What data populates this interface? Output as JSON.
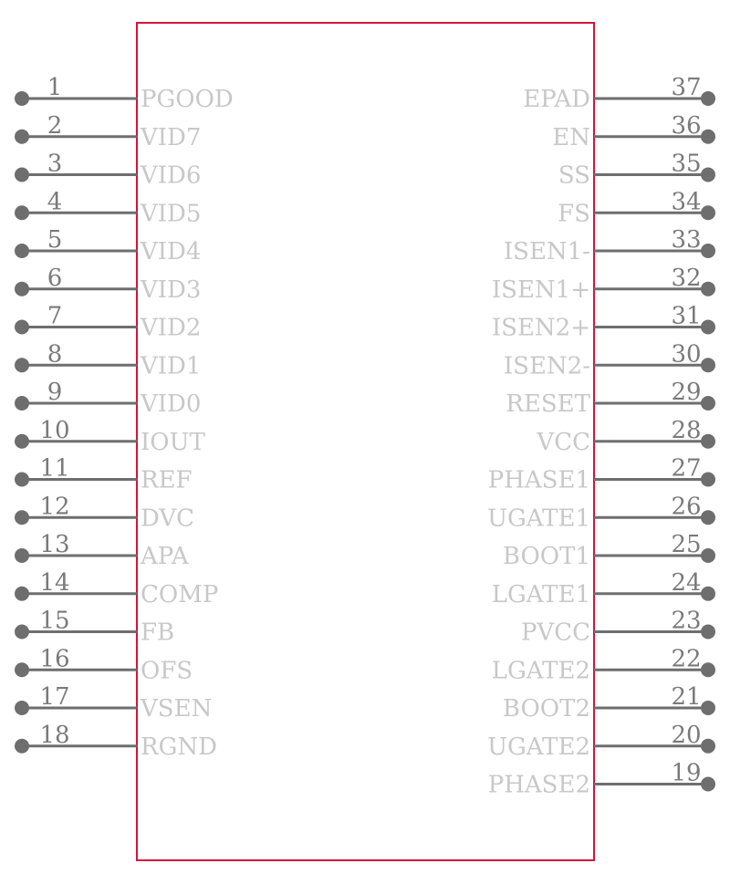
{
  "component": {
    "body_color": "#d4143c",
    "pin_color": "#6e6e6e",
    "label_color": "#c8c8c8",
    "number_color": "#7a7a7a"
  },
  "left_pins": [
    {
      "number": "1",
      "name": "PGOOD"
    },
    {
      "number": "2",
      "name": "VID7"
    },
    {
      "number": "3",
      "name": "VID6"
    },
    {
      "number": "4",
      "name": "VID5"
    },
    {
      "number": "5",
      "name": "VID4"
    },
    {
      "number": "6",
      "name": "VID3"
    },
    {
      "number": "7",
      "name": "VID2"
    },
    {
      "number": "8",
      "name": "VID1"
    },
    {
      "number": "9",
      "name": "VID0"
    },
    {
      "number": "10",
      "name": "IOUT"
    },
    {
      "number": "11",
      "name": "REF"
    },
    {
      "number": "12",
      "name": "DVC"
    },
    {
      "number": "13",
      "name": "APA"
    },
    {
      "number": "14",
      "name": "COMP"
    },
    {
      "number": "15",
      "name": "FB"
    },
    {
      "number": "16",
      "name": "OFS"
    },
    {
      "number": "17",
      "name": "VSEN"
    },
    {
      "number": "18",
      "name": "RGND"
    }
  ],
  "right_pins": [
    {
      "number": "37",
      "name": "EPAD"
    },
    {
      "number": "36",
      "name": "EN"
    },
    {
      "number": "35",
      "name": "SS"
    },
    {
      "number": "34",
      "name": "FS"
    },
    {
      "number": "33",
      "name": "ISEN1-"
    },
    {
      "number": "32",
      "name": "ISEN1+"
    },
    {
      "number": "31",
      "name": "ISEN2+"
    },
    {
      "number": "30",
      "name": "ISEN2-"
    },
    {
      "number": "29",
      "name": "RESET"
    },
    {
      "number": "28",
      "name": "VCC"
    },
    {
      "number": "27",
      "name": "PHASE1"
    },
    {
      "number": "26",
      "name": "UGATE1"
    },
    {
      "number": "25",
      "name": "BOOT1"
    },
    {
      "number": "24",
      "name": "LGATE1"
    },
    {
      "number": "23",
      "name": "PVCC"
    },
    {
      "number": "22",
      "name": "LGATE2"
    },
    {
      "number": "21",
      "name": "BOOT2"
    },
    {
      "number": "20",
      "name": "UGATE2"
    },
    {
      "number": "19",
      "name": "PHASE2"
    }
  ]
}
